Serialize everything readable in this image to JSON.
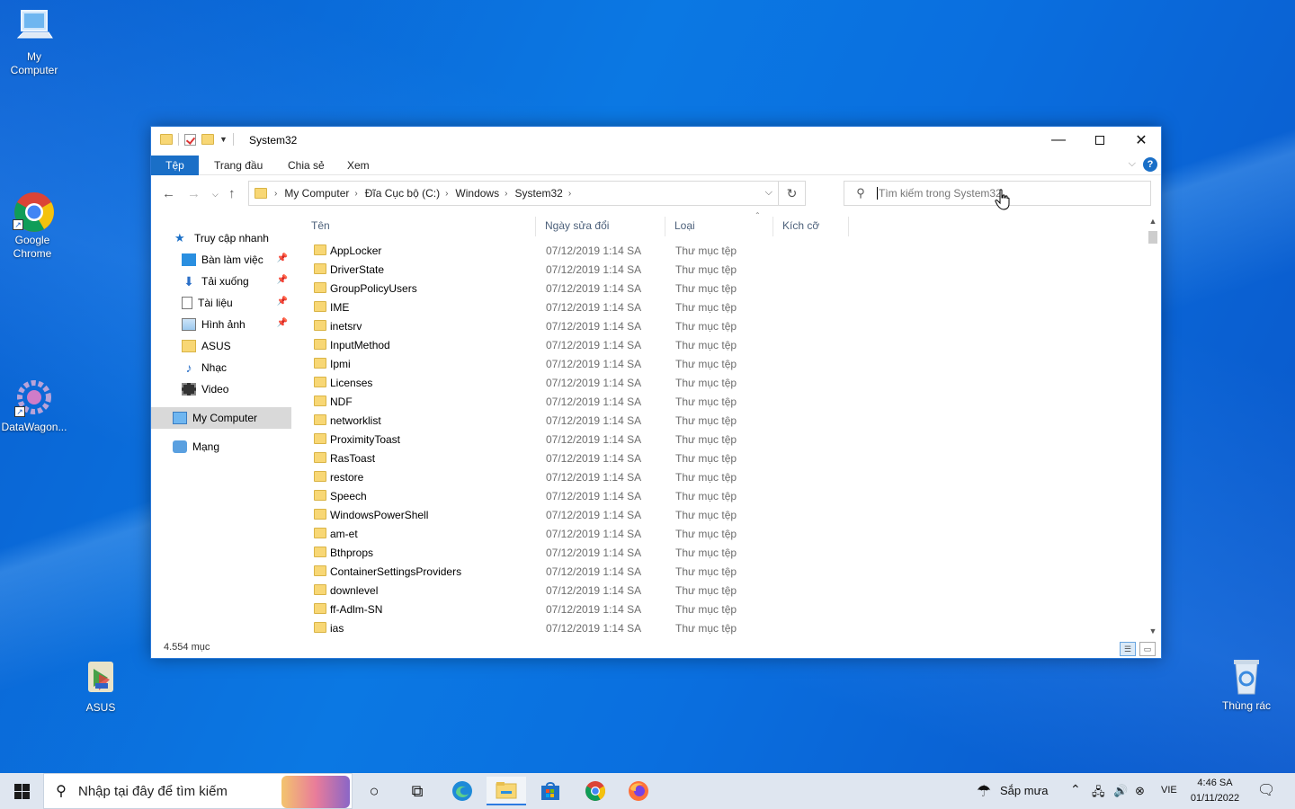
{
  "desktop": {
    "icons": [
      {
        "label_line1": "My",
        "label_line2": "Computer"
      },
      {
        "label_line1": "Google",
        "label_line2": "Chrome"
      },
      {
        "label_line1": "DataWagon...",
        "label_line2": ""
      },
      {
        "label_line1": "ASUS",
        "label_line2": ""
      },
      {
        "label_line1": "Thùng rác",
        "label_line2": ""
      }
    ]
  },
  "window": {
    "title": "System32",
    "ribbon_tabs": [
      "Tệp",
      "Trang đầu",
      "Chia sẻ",
      "Xem"
    ],
    "help_label": "?",
    "breadcrumb": [
      "My Computer",
      "Đĩa Cục bộ (C:)",
      "Windows",
      "System32"
    ],
    "search_placeholder": "Tìm kiếm trong System32",
    "nav": {
      "quick_access": "Truy cập nhanh",
      "items": [
        "Bàn làm việc",
        "Tải xuống",
        "Tài liệu",
        "Hình ảnh",
        "ASUS",
        "Nhạc",
        "Video"
      ],
      "my_computer": "My Computer",
      "network": "Mạng"
    },
    "columns": [
      "Tên",
      "Ngày sửa đổi",
      "Loại",
      "Kích cỡ"
    ],
    "files": [
      {
        "name": "AppLocker",
        "date": "07/12/2019 1:14 SA",
        "type": "Thư mục tệp"
      },
      {
        "name": "DriverState",
        "date": "07/12/2019 1:14 SA",
        "type": "Thư mục tệp"
      },
      {
        "name": "GroupPolicyUsers",
        "date": "07/12/2019 1:14 SA",
        "type": "Thư mục tệp"
      },
      {
        "name": "IME",
        "date": "07/12/2019 1:14 SA",
        "type": "Thư mục tệp"
      },
      {
        "name": "inetsrv",
        "date": "07/12/2019 1:14 SA",
        "type": "Thư mục tệp"
      },
      {
        "name": "InputMethod",
        "date": "07/12/2019 1:14 SA",
        "type": "Thư mục tệp"
      },
      {
        "name": "Ipmi",
        "date": "07/12/2019 1:14 SA",
        "type": "Thư mục tệp"
      },
      {
        "name": "Licenses",
        "date": "07/12/2019 1:14 SA",
        "type": "Thư mục tệp"
      },
      {
        "name": "NDF",
        "date": "07/12/2019 1:14 SA",
        "type": "Thư mục tệp"
      },
      {
        "name": "networklist",
        "date": "07/12/2019 1:14 SA",
        "type": "Thư mục tệp"
      },
      {
        "name": "ProximityToast",
        "date": "07/12/2019 1:14 SA",
        "type": "Thư mục tệp"
      },
      {
        "name": "RasToast",
        "date": "07/12/2019 1:14 SA",
        "type": "Thư mục tệp"
      },
      {
        "name": "restore",
        "date": "07/12/2019 1:14 SA",
        "type": "Thư mục tệp"
      },
      {
        "name": "Speech",
        "date": "07/12/2019 1:14 SA",
        "type": "Thư mục tệp"
      },
      {
        "name": "WindowsPowerShell",
        "date": "07/12/2019 1:14 SA",
        "type": "Thư mục tệp"
      },
      {
        "name": "am-et",
        "date": "07/12/2019 1:14 SA",
        "type": "Thư mục tệp"
      },
      {
        "name": "Bthprops",
        "date": "07/12/2019 1:14 SA",
        "type": "Thư mục tệp"
      },
      {
        "name": "ContainerSettingsProviders",
        "date": "07/12/2019 1:14 SA",
        "type": "Thư mục tệp"
      },
      {
        "name": "downlevel",
        "date": "07/12/2019 1:14 SA",
        "type": "Thư mục tệp"
      },
      {
        "name": "ff-Adlm-SN",
        "date": "07/12/2019 1:14 SA",
        "type": "Thư mục tệp"
      },
      {
        "name": "ias",
        "date": "07/12/2019 1:14 SA",
        "type": "Thư mục tệp"
      }
    ],
    "status": "4.554 mục"
  },
  "taskbar": {
    "search_placeholder": "Nhập tại đây để tìm kiếm",
    "weather": "Sắp mưa",
    "language": "VIE",
    "time": "4:46 SA",
    "date": "01/11/2022"
  },
  "colors": {
    "accent": "#1a6fc7",
    "folder": "#f8d775",
    "desktop": "#0b78e3"
  }
}
